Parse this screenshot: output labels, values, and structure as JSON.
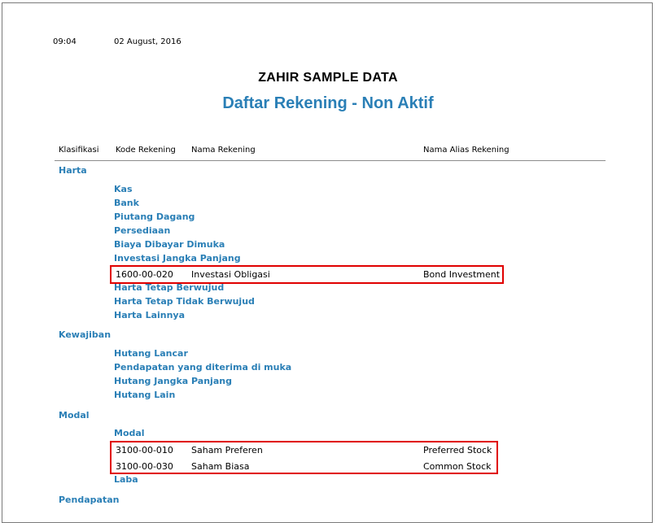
{
  "header": {
    "time": "09:04",
    "date": "02 August, 2016",
    "company": "ZAHIR SAMPLE DATA",
    "title": "Daftar Rekening - Non Aktif"
  },
  "columns": {
    "klasifikasi": "Klasifikasi",
    "kode": "Kode Rekening",
    "nama": "Nama Rekening",
    "alias": "Nama Alias Rekening"
  },
  "classifications": {
    "harta": "Harta",
    "kewajiban": "Kewajiban",
    "modal": "Modal",
    "pendapatan": "Pendapatan"
  },
  "groups": {
    "kas": "Kas",
    "bank": "Bank",
    "piutang_dagang": "Piutang Dagang",
    "persediaan": "Persediaan",
    "biaya_dibayar_dimuka": "Biaya Dibayar Dimuka",
    "investasi_jangka_panjang": "Investasi Jangka Panjang",
    "harta_tetap_berwujud": "Harta Tetap Berwujud",
    "harta_tetap_tidak_berwujud": "Harta Tetap Tidak Berwujud",
    "harta_lainnya": "Harta Lainnya",
    "hutang_lancar": "Hutang Lancar",
    "pendapatan_diterima_dimuka": "Pendapatan yang diterima di muka",
    "hutang_jangka_panjang": "Hutang Jangka Panjang",
    "hutang_lain": "Hutang Lain",
    "modal": "Modal",
    "laba": "Laba"
  },
  "accounts": [
    {
      "kode": "1600-00-020",
      "nama": "Investasi Obligasi",
      "alias": "Bond Investment"
    },
    {
      "kode": "3100-00-010",
      "nama": "Saham Preferen",
      "alias": "Preferred Stock"
    },
    {
      "kode": "3100-00-030",
      "nama": "Saham Biasa",
      "alias": "Common Stock"
    }
  ],
  "highlight_color": "#e00000",
  "accent_color": "#2a7fb6"
}
